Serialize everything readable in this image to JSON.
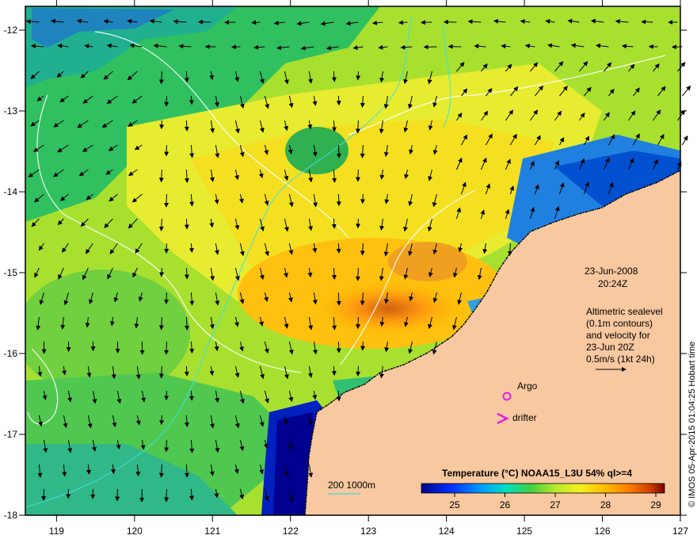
{
  "map": {
    "datetime": {
      "date": "23-Jun-2008",
      "time": "20:24Z"
    },
    "altimetry_note": [
      "Altimetric sealevel",
      "(0.1m contours)",
      "and velocity for",
      "23-Jun 20Z",
      "0.5m/s (1kt 24h)"
    ],
    "legend_argo": "Argo",
    "legend_drifter": "drifter",
    "isobath_label": "200  1000m",
    "colorbar": {
      "title": "Temperature (°C) NOAA15_L3U 54% ql>=4",
      "ticks": [
        "25",
        "26",
        "27",
        "28",
        "29"
      ],
      "colors": [
        "#00008b",
        "#0000ff",
        "#0080ff",
        "#00c8ff",
        "#00e0a0",
        "#40d040",
        "#a0e040",
        "#e8f020",
        "#ffd000",
        "#ff9000",
        "#e06000",
        "#b02000",
        "#7a0000"
      ]
    },
    "credit": "© IMOS 05-Apr-2015 01:04:25 Hobart time",
    "x_ticks": [
      "119",
      "120",
      "121",
      "122",
      "123",
      "124",
      "125",
      "126",
      "127"
    ],
    "y_ticks": [
      "-12",
      "-13",
      "-14",
      "-15",
      "-16",
      "-17",
      "-18"
    ],
    "colors": {
      "land": "#f8c8a0",
      "argo": "#e020e0",
      "drifter": "#e020e0",
      "isobath": "#40e0e0",
      "contour": "#ffffff"
    }
  }
}
